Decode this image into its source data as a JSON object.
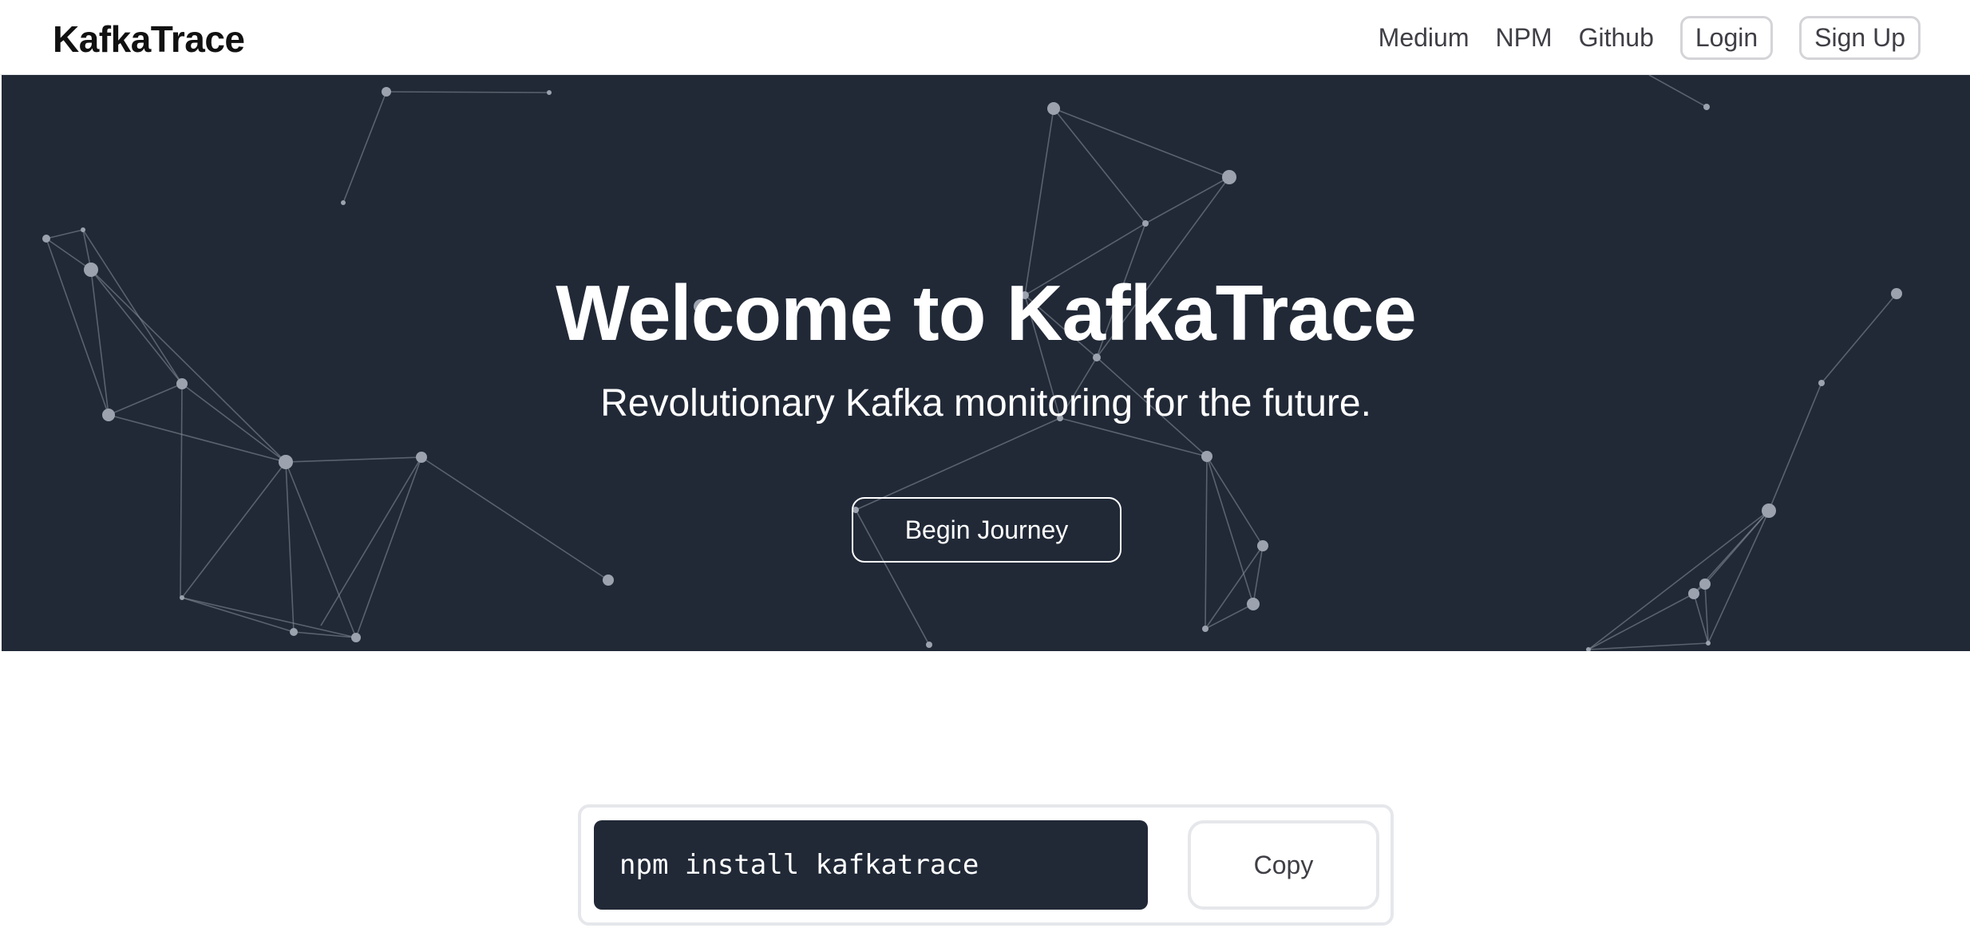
{
  "brand": "KafkaTrace",
  "nav": {
    "medium": "Medium",
    "npm": "NPM",
    "github": "Github",
    "login": "Login",
    "signup": "Sign Up"
  },
  "hero": {
    "title": "Welcome to KafkaTrace",
    "subtitle": "Revolutionary Kafka monitoring for the future.",
    "cta": "Begin Journey"
  },
  "install": {
    "command": "npm install kafkatrace",
    "copy_label": "Copy"
  },
  "colors": {
    "hero_bg": "#212937",
    "particle": "#9ca3af"
  },
  "icons": {
    "background": "particle-network-icon"
  }
}
